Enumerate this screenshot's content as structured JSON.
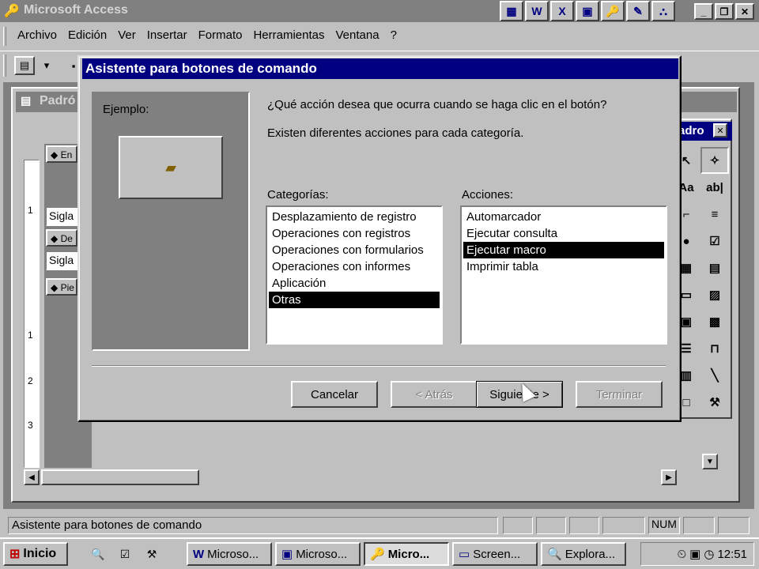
{
  "app": {
    "title": "Microsoft Access",
    "menu": [
      "Archivo",
      "Edición",
      "Ver",
      "Insertar",
      "Formato",
      "Herramientas",
      "Ventana",
      "?"
    ]
  },
  "form_window": {
    "title": "Padró",
    "sections": [
      "En",
      "De",
      "Pie"
    ],
    "fields": [
      "Sigla",
      "Sigla"
    ],
    "ruler_marks": [
      "1",
      "1",
      "2",
      "3"
    ]
  },
  "toolbox": {
    "title": "adro",
    "tools": [
      "pointer-icon",
      "wizard-icon",
      "label-icon",
      "textbox-icon",
      "option-group-icon",
      "toggle-icon",
      "radio-icon",
      "checkbox-icon",
      "combo-icon",
      "list-icon",
      "button-icon",
      "image-icon",
      "unbound-frame-icon",
      "bound-frame-icon",
      "page-break-icon",
      "tab-icon",
      "subform-icon",
      "line-icon",
      "rectangle-icon",
      "more-tools-icon"
    ],
    "label_glyph": "Aa",
    "textbox_glyph": "ab|"
  },
  "wizard": {
    "title": "Asistente para botones de comando",
    "example_label": "Ejemplo:",
    "question": "¿Qué acción desea que ocurra cuando se haga clic en el botón?",
    "description": "Existen diferentes acciones para cada categoría.",
    "categories_label": "Categorías:",
    "actions_label": "Acciones:",
    "categories": [
      {
        "label": "Desplazamiento de registro",
        "selected": false
      },
      {
        "label": "Operaciones con registros",
        "selected": false
      },
      {
        "label": "Operaciones con formularios",
        "selected": false
      },
      {
        "label": "Operaciones con informes",
        "selected": false
      },
      {
        "label": "Aplicación",
        "selected": false
      },
      {
        "label": "Otras",
        "selected": true
      }
    ],
    "actions": [
      {
        "label": "Automarcador",
        "selected": false
      },
      {
        "label": "Ejecutar consulta",
        "selected": false
      },
      {
        "label": "Ejecutar macro",
        "selected": true
      },
      {
        "label": "Imprimir tabla",
        "selected": false
      }
    ],
    "buttons": {
      "cancel": "Cancelar",
      "back": "< Atrás",
      "next": "Siguiente >",
      "finish": "Terminar"
    }
  },
  "status": {
    "text": "Asistente para botones de comando",
    "num": "NUM"
  },
  "taskbar": {
    "start": "Inicio",
    "tasks": [
      {
        "label": "Microso...",
        "icon": "word-icon",
        "active": false
      },
      {
        "label": "Microso...",
        "icon": "access-form-icon",
        "active": false
      },
      {
        "label": "Micro...",
        "icon": "access-key-icon",
        "active": true
      },
      {
        "label": "Screen...",
        "icon": "screen-icon",
        "active": false
      },
      {
        "label": "Explora...",
        "icon": "explorer-icon",
        "active": false
      }
    ],
    "clock": "12:51"
  }
}
